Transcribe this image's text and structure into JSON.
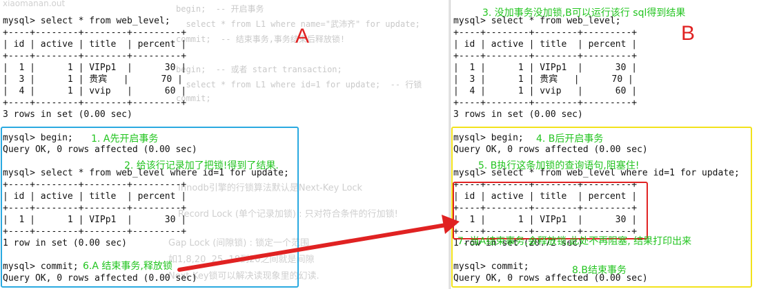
{
  "pane_a": {
    "label": "A",
    "faded_title": "xiaomanan.out",
    "terminal": [
      "mysql> select * from web_level;",
      "+----+--------+--------+---------+",
      "| id | active | title  | percent |",
      "+----+--------+--------+---------+",
      "|  1 |      1 | VIPp1  |      30 |",
      "|  3 |      1 | 贵宾   |      70 |",
      "|  4 |      1 | vvip   |      60 |",
      "+----+--------+--------+---------+",
      "3 rows in set (0.00 sec)",
      "",
      "mysql> begin;",
      "Query OK, 0 rows affected (0.00 sec)",
      "",
      "mysql> select * from web_level where id=1 for update;",
      "+----+--------+--------+---------+",
      "| id | active | title  | percent |",
      "+----+--------+--------+---------+",
      "|  1 |      1 | VIPp1  |      30 |",
      "+----+--------+--------+---------+",
      "1 row in set (0.00 sec)",
      "",
      "mysql> commit;",
      "Query OK, 0 rows affected (0.00 sec)"
    ],
    "bg_code": [
      "begin;  -- 开启事务",
      "  select * from L1 where name=\"武沛齐\" for update;",
      "commit;  -- 结束事务,事务结束后释放锁!",
      "",
      "begin;  -- 或者 start transaction;",
      "  select * from L1 where id=1 for update;  -- 行锁",
      "commit;"
    ],
    "bg_doc": [
      "Innodb引擎的行锁算法默认是Next-Key Lock",
      "Record Lock (单个记录加锁) : 只对符合条件的行加锁!",
      "Gap Lock (间隙锁) : 锁定一个范围",
      "如1,8,20  25, 18到20之间就是间隙",
      "Next-Key锁可以解决读现象里的幻读."
    ],
    "notes": {
      "n1": "1. A先开启事务",
      "n2": "2. 给该行记录加了把锁!得到了结果.",
      "n6": "6.A 结束事务,释放锁"
    }
  },
  "pane_b": {
    "label": "B",
    "terminal": [
      "mysql> select * from web_level;",
      "+----+--------+--------+---------+",
      "| id | active | title  | percent |",
      "+----+--------+--------+---------+",
      "|  1 |      1 | VIPp1  |      30 |",
      "|  3 |      1 | 贵宾   |      70 |",
      "|  4 |      1 | vvip   |      60 |",
      "+----+--------+--------+---------+",
      "3 rows in set (0.00 sec)",
      "",
      "mysql> begin;",
      "Query OK, 0 rows affected (0.00 sec)",
      "",
      "mysql> select * from web_level where id=1 for update;",
      "+----+--------+--------+---------+",
      "| id | active | title  | percent |",
      "+----+--------+--------+---------+",
      "|  1 |      1 | VIPp1  |      30 |",
      "+----+--------+--------+---------+",
      "1 row in set (20.72 sec)",
      "",
      "mysql> commit;",
      "Query OK, 0 rows affected (0.00 sec)"
    ],
    "notes": {
      "n3": "3. 没加事务没加锁,B可以运行该行 sql得到结果",
      "n4": "4. B后开启事务",
      "n5": "5. B执行这条加锁的查询语句,阻塞住!",
      "n7": "7. 当A结束事务,会释放锁,此处不再阻塞, 结果打印出来",
      "n8": "8.B结束事务"
    }
  },
  "colors": {
    "note_green": "#22c41f",
    "label_red": "#e02222",
    "box_blue": "#29a9e0",
    "box_yellow": "#f2e21a",
    "box_red": "#e02222",
    "arrow_red": "#e02222"
  }
}
